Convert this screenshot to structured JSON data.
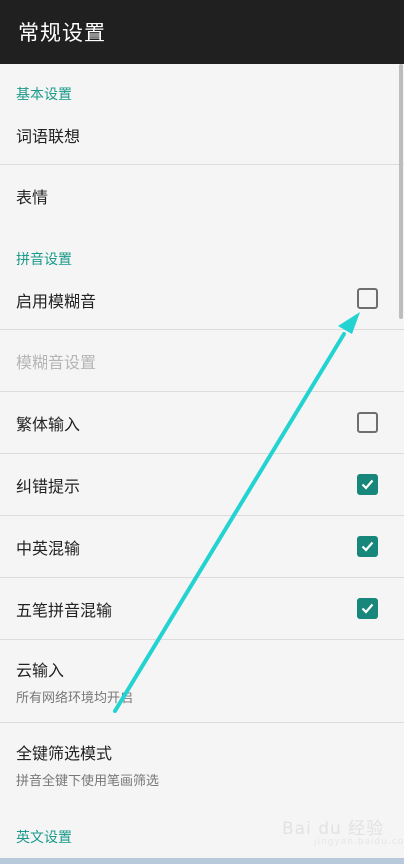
{
  "appbar": {
    "title": "常规设置"
  },
  "sections": {
    "basic": "基本设置",
    "pinyin": "拼音设置",
    "english": "英文设置"
  },
  "items": {
    "word_assoc": {
      "label": "词语联想"
    },
    "emoji": {
      "label": "表情"
    },
    "fuzzy_enable": {
      "label": "启用模糊音",
      "checked": false
    },
    "fuzzy_settings": {
      "label": "模糊音设置",
      "enabled": false
    },
    "traditional": {
      "label": "繁体输入",
      "checked": false
    },
    "correction": {
      "label": "纠错提示",
      "checked": true
    },
    "cn_en_mix": {
      "label": "中英混输",
      "checked": true
    },
    "wubi_pinyin": {
      "label": "五笔拼音混输",
      "checked": true
    },
    "cloud": {
      "label": "云输入",
      "sub": "所有网络环境均开启"
    },
    "full_key_filter": {
      "label": "全键筛选模式",
      "sub": "拼音全键下使用笔画筛选"
    }
  },
  "watermark": {
    "text": "Bai du 经验",
    "sub": "jingyan.baidu.com"
  },
  "colors": {
    "accent": "#1a9a8a",
    "checkbox_on": "#16877a",
    "appbar": "#202020",
    "arrow": "#22d3d1"
  },
  "icons": {
    "checkmark": "check-icon",
    "annotation_arrow": "arrow-icon"
  }
}
